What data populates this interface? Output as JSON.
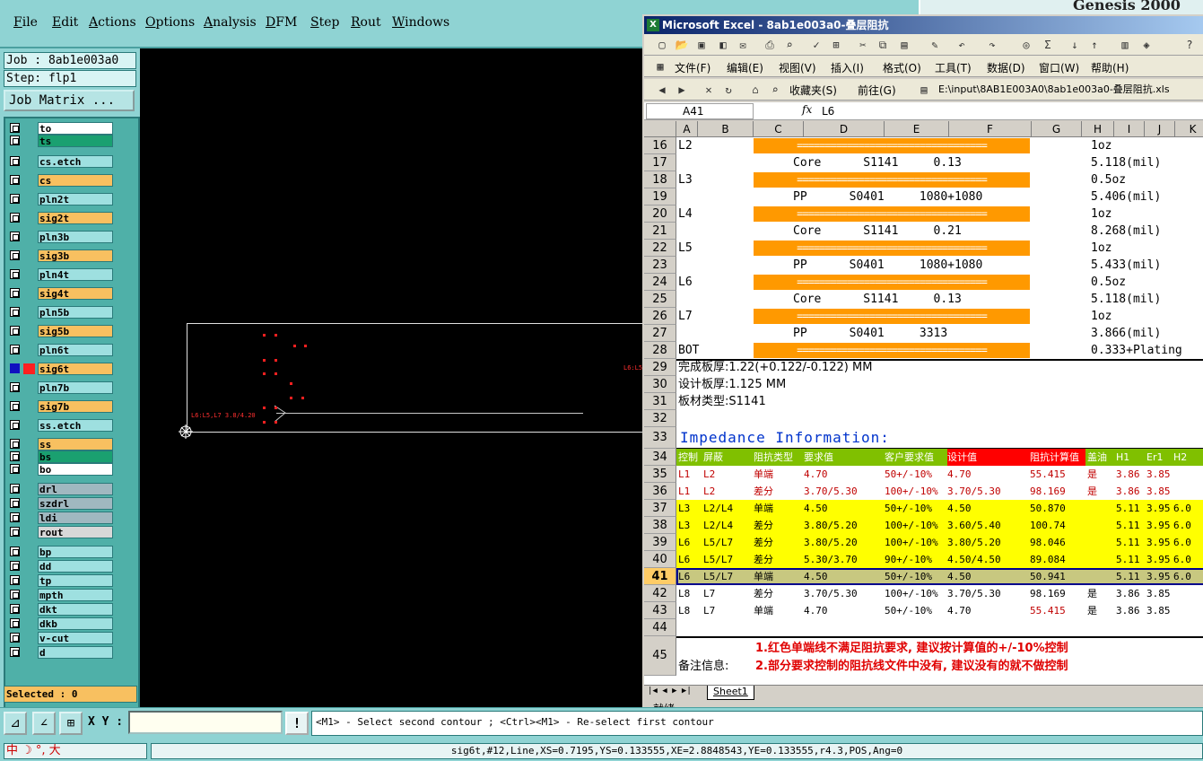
{
  "menubar": {
    "items": [
      "File",
      "Edit",
      "Actions",
      "Options",
      "Analysis",
      "DFM",
      "Step",
      "Rout",
      "Windows"
    ]
  },
  "genesis_title": "Genesis 2000",
  "left": {
    "job": "Job : 8ab1e003a0",
    "step": "Step: flp1",
    "job_matrix": "Job Matrix ...",
    "selected": "Selected : 0",
    "layers": [
      {
        "name": "to",
        "color": "#ffffff"
      },
      {
        "name": "ts",
        "color": "#1aa070"
      },
      {
        "name": "cs.etch",
        "color": "#9ee0e0"
      },
      {
        "name": "cs",
        "color": "#f8c060"
      },
      {
        "name": "pln2t",
        "color": "#9ee0e0"
      },
      {
        "name": "sig2t",
        "color": "#f8c060"
      },
      {
        "name": "pln3b",
        "color": "#9ee0e0"
      },
      {
        "name": "sig3b",
        "color": "#f8c060"
      },
      {
        "name": "pln4t",
        "color": "#9ee0e0"
      },
      {
        "name": "sig4t",
        "color": "#f8c060"
      },
      {
        "name": "pln5b",
        "color": "#9ee0e0"
      },
      {
        "name": "sig5b",
        "color": "#f8c060"
      },
      {
        "name": "pln6t",
        "color": "#9ee0e0"
      },
      {
        "name": "sig6t",
        "color": "#f8c060"
      },
      {
        "name": "pln7b",
        "color": "#9ee0e0"
      },
      {
        "name": "sig7b",
        "color": "#f8c060"
      },
      {
        "name": "ss.etch",
        "color": "#9ee0e0"
      },
      {
        "name": "ss",
        "color": "#f8c060"
      },
      {
        "name": "bs",
        "color": "#1aa070"
      },
      {
        "name": "bo",
        "color": "#ffffff"
      },
      {
        "name": "drl",
        "color": "#a0b8c0"
      },
      {
        "name": "szdrl",
        "color": "#a0b8c0"
      },
      {
        "name": "ldi",
        "color": "#a0b8c0"
      },
      {
        "name": "rout",
        "color": "#d8d8d8"
      },
      {
        "name": "bp",
        "color": "#9ee0e0"
      },
      {
        "name": "dd",
        "color": "#9ee0e0"
      },
      {
        "name": "tp",
        "color": "#9ee0e0"
      },
      {
        "name": "mpth",
        "color": "#9ee0e0"
      },
      {
        "name": "dkt",
        "color": "#9ee0e0"
      },
      {
        "name": "dkb",
        "color": "#9ee0e0"
      },
      {
        "name": "v-cut",
        "color": "#9ee0e0"
      },
      {
        "name": "d",
        "color": "#9ee0e0"
      }
    ]
  },
  "canvas": {
    "label_left": "L6:L5,L7 3.8/4.20",
    "label_right": "L6:L5"
  },
  "bottom": {
    "xy_label": "X Y :",
    "xy_value": "",
    "warn": "!",
    "prompt": "<M1> - Select second contour ; <Ctrl><M1> - Re-select first contour"
  },
  "status": {
    "ime": "中 ☽ °, 大",
    "text": "sig6t,#12,Line,XS=0.7195,YS=0.133555,XE=2.8848543,YE=0.133555,r4.3,POS,Ang=0"
  },
  "excel": {
    "title": "Microsoft Excel - 8ab1e003a0-叠层阻抗",
    "menus": [
      "文件(F)",
      "编辑(E)",
      "视图(V)",
      "插入(I)",
      "格式(O)",
      "工具(T)",
      "数据(D)",
      "窗口(W)",
      "帮助(H)"
    ],
    "favorites": "收藏夹(S)",
    "goto": "前往(G)",
    "path": "E:\\input\\8AB1E003A0\\8ab1e003a0-叠层阻抗.xls",
    "namebox": "A41",
    "fx": "fx",
    "formula": "L6",
    "columns": [
      "A",
      "B",
      "C",
      "D",
      "E",
      "F",
      "G",
      "H",
      "I",
      "J",
      "K"
    ],
    "sheet_tab": "Sheet1",
    "status": "就绪",
    "stack_rows": [
      {
        "row": "16",
        "a": "L2",
        "bar": true,
        "text": "",
        "h": "1oz"
      },
      {
        "row": "17",
        "a": "",
        "bar": false,
        "text": "Core      S1141     0.13",
        "h": "5.118(mil)"
      },
      {
        "row": "18",
        "a": "L3",
        "bar": true,
        "text": "",
        "h": "0.5oz"
      },
      {
        "row": "19",
        "a": "",
        "bar": false,
        "text": "PP      S0401     1080+1080",
        "h": "5.406(mil)"
      },
      {
        "row": "20",
        "a": "L4",
        "bar": true,
        "text": "",
        "h": "1oz"
      },
      {
        "row": "21",
        "a": "",
        "bar": false,
        "text": "Core      S1141     0.21",
        "h": "8.268(mil)"
      },
      {
        "row": "22",
        "a": "L5",
        "bar": true,
        "text": "",
        "h": "1oz"
      },
      {
        "row": "23",
        "a": "",
        "bar": false,
        "text": "PP      S0401     1080+1080",
        "h": "5.433(mil)"
      },
      {
        "row": "24",
        "a": "L6",
        "bar": true,
        "text": "",
        "h": "0.5oz"
      },
      {
        "row": "25",
        "a": "",
        "bar": false,
        "text": "Core      S1141     0.13",
        "h": "5.118(mil)"
      },
      {
        "row": "26",
        "a": "L7",
        "bar": true,
        "text": "",
        "h": "1oz"
      },
      {
        "row": "27",
        "a": "",
        "bar": false,
        "text": "PP      S0401     3313",
        "h": "3.866(mil)"
      },
      {
        "row": "28",
        "a": "BOT",
        "bar": true,
        "text": "",
        "h": "0.333+Plating"
      }
    ],
    "bar_text": "==================================",
    "row29": "完成板厚:1.22(+0.122/-0.122) MM",
    "row30": "设计板厚:1.125 MM",
    "row31": "板材类型:S1141",
    "row33": "Impedance Information:",
    "imp_header": [
      "控制",
      "屏蔽",
      "阻抗类型",
      "要求值",
      "客户要求值",
      "设计值",
      "阻抗计算值",
      "盖油",
      "H1",
      "Er1",
      "H2"
    ],
    "imp_rows": [
      {
        "row": "35",
        "bg": "#ffffff",
        "color": "#c00000",
        "cells": [
          "L1",
          "L2",
          "单端",
          "4.70",
          "50+/-10%",
          "4.70",
          "55.415",
          "是",
          "3.86",
          "3.85",
          ""
        ]
      },
      {
        "row": "36",
        "bg": "#ffffff",
        "color": "#c00000",
        "cells": [
          "L1",
          "L2",
          "差分",
          "3.70/5.30",
          "100+/-10%",
          "3.70/5.30",
          "98.169",
          "是",
          "3.86",
          "3.85",
          ""
        ]
      },
      {
        "row": "37",
        "bg": "#ffff00",
        "color": "#000000",
        "cells": [
          "L3",
          "L2/L4",
          "单端",
          "4.50",
          "50+/-10%",
          "4.50",
          "50.870",
          "",
          "5.11",
          "3.95",
          "6.0"
        ]
      },
      {
        "row": "38",
        "bg": "#ffff00",
        "color": "#000000",
        "cells": [
          "L3",
          "L2/L4",
          "差分",
          "3.80/5.20",
          "100+/-10%",
          "3.60/5.40",
          "100.74",
          "",
          "5.11",
          "3.95",
          "6.0"
        ]
      },
      {
        "row": "39",
        "bg": "#ffff00",
        "color": "#000000",
        "cells": [
          "L6",
          "L5/L7",
          "差分",
          "3.80/5.20",
          "100+/-10%",
          "3.80/5.20",
          "98.046",
          "",
          "5.11",
          "3.95",
          "6.0"
        ]
      },
      {
        "row": "40",
        "bg": "#ffff00",
        "color": "#000000",
        "cells": [
          "L6",
          "L5/L7",
          "差分",
          "5.30/3.70",
          "90+/-10%",
          "4.50/4.50",
          "89.084",
          "",
          "5.11",
          "3.95",
          "6.0"
        ]
      },
      {
        "row": "41",
        "bg": "#c8c880",
        "color": "#000000",
        "cells": [
          "L6",
          "L5/L7",
          "单端",
          "4.50",
          "50+/-10%",
          "4.50",
          "50.941",
          "",
          "5.11",
          "3.95",
          "6.0"
        ]
      },
      {
        "row": "42",
        "bg": "#ffffff",
        "color": "#000000",
        "cells": [
          "L8",
          "L7",
          "差分",
          "3.70/5.30",
          "100+/-10%",
          "3.70/5.30",
          "98.169",
          "是",
          "3.86",
          "3.85",
          ""
        ]
      },
      {
        "row": "43",
        "bg": "#ffffff",
        "color": "#000000",
        "cells": [
          "L8",
          "L7",
          "单端",
          "4.70",
          "50+/-10%",
          "4.70",
          "55.415",
          "是",
          "3.86",
          "3.85",
          ""
        ]
      }
    ],
    "note_label": "备注信息:",
    "note1": "1.红色单端线不满足阻抗要求, 建议按计算值的+/-10%控制",
    "note2": "2.部分要求控制的阻抗线文件中没有, 建议没有的就不做控制"
  }
}
